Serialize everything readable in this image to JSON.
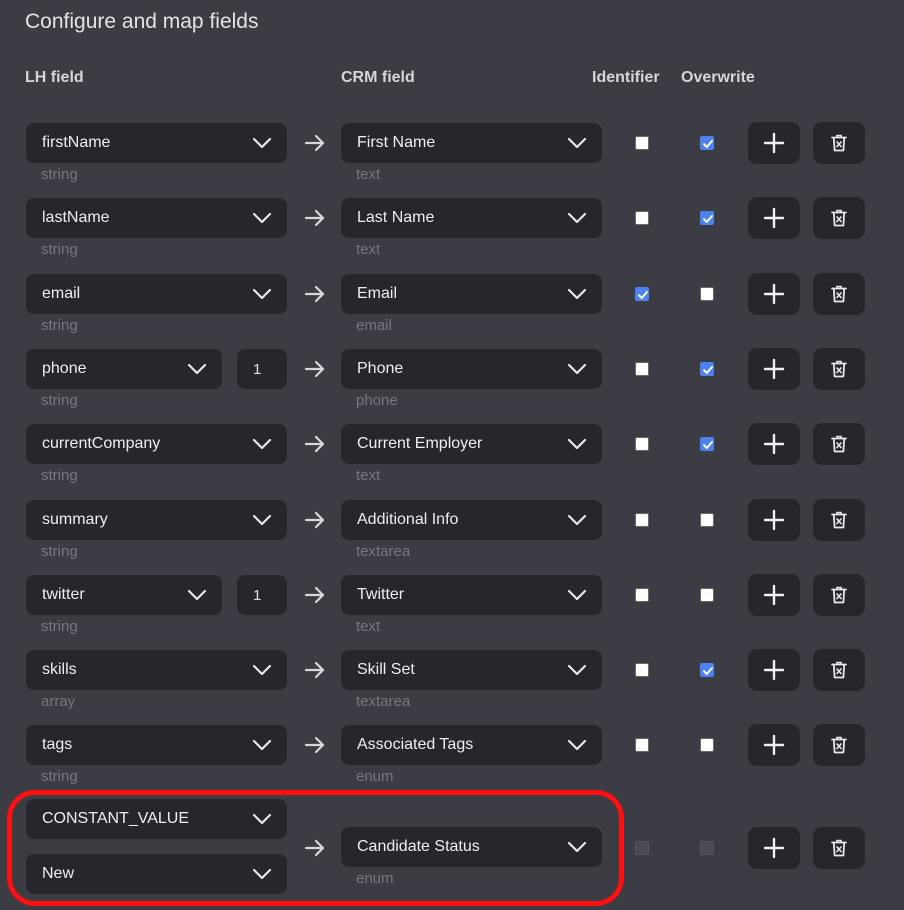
{
  "title": "Configure and map fields",
  "headers": {
    "lh": "LH field",
    "crm": "CRM field",
    "identifier": "Identifier",
    "overwrite": "Overwrite"
  },
  "rows": [
    {
      "lh": "firstName",
      "lh_type": "string",
      "crm": "First Name",
      "crm_type": "text",
      "identifier": false,
      "overwrite": true
    },
    {
      "lh": "lastName",
      "lh_type": "string",
      "crm": "Last Name",
      "crm_type": "text",
      "identifier": false,
      "overwrite": true
    },
    {
      "lh": "email",
      "lh_type": "string",
      "crm": "Email",
      "crm_type": "email",
      "identifier": true,
      "overwrite": false
    },
    {
      "lh": "phone",
      "lh_type": "string",
      "index": "1",
      "crm": "Phone",
      "crm_type": "phone",
      "identifier": false,
      "overwrite": true
    },
    {
      "lh": "currentCompany",
      "lh_type": "string",
      "crm": "Current Employer",
      "crm_type": "text",
      "identifier": false,
      "overwrite": true
    },
    {
      "lh": "summary",
      "lh_type": "string",
      "crm": "Additional Info",
      "crm_type": "textarea",
      "identifier": false,
      "overwrite": false
    },
    {
      "lh": "twitter",
      "lh_type": "string",
      "index": "1",
      "crm": "Twitter",
      "crm_type": "text",
      "identifier": false,
      "overwrite": false
    },
    {
      "lh": "skills",
      "lh_type": "array",
      "crm": "Skill Set",
      "crm_type": "textarea",
      "identifier": false,
      "overwrite": true
    },
    {
      "lh": "tags",
      "lh_type": "string",
      "crm": "Associated Tags",
      "crm_type": "enum",
      "identifier": false,
      "overwrite": false
    }
  ],
  "constant_row": {
    "lh": "CONSTANT_VALUE",
    "value": "New",
    "crm": "Candidate Status",
    "crm_type": "enum",
    "identifier": false,
    "overwrite": false,
    "disabled": true
  },
  "colors": {
    "background": "#3b3c44",
    "control": "#26272c",
    "accent": "#4c82f0",
    "highlight": "#ff1010"
  },
  "icons": {
    "dropdown": "chevron-down-icon",
    "map": "arrow-right-icon",
    "add": "plus-icon",
    "delete": "trash-icon"
  }
}
